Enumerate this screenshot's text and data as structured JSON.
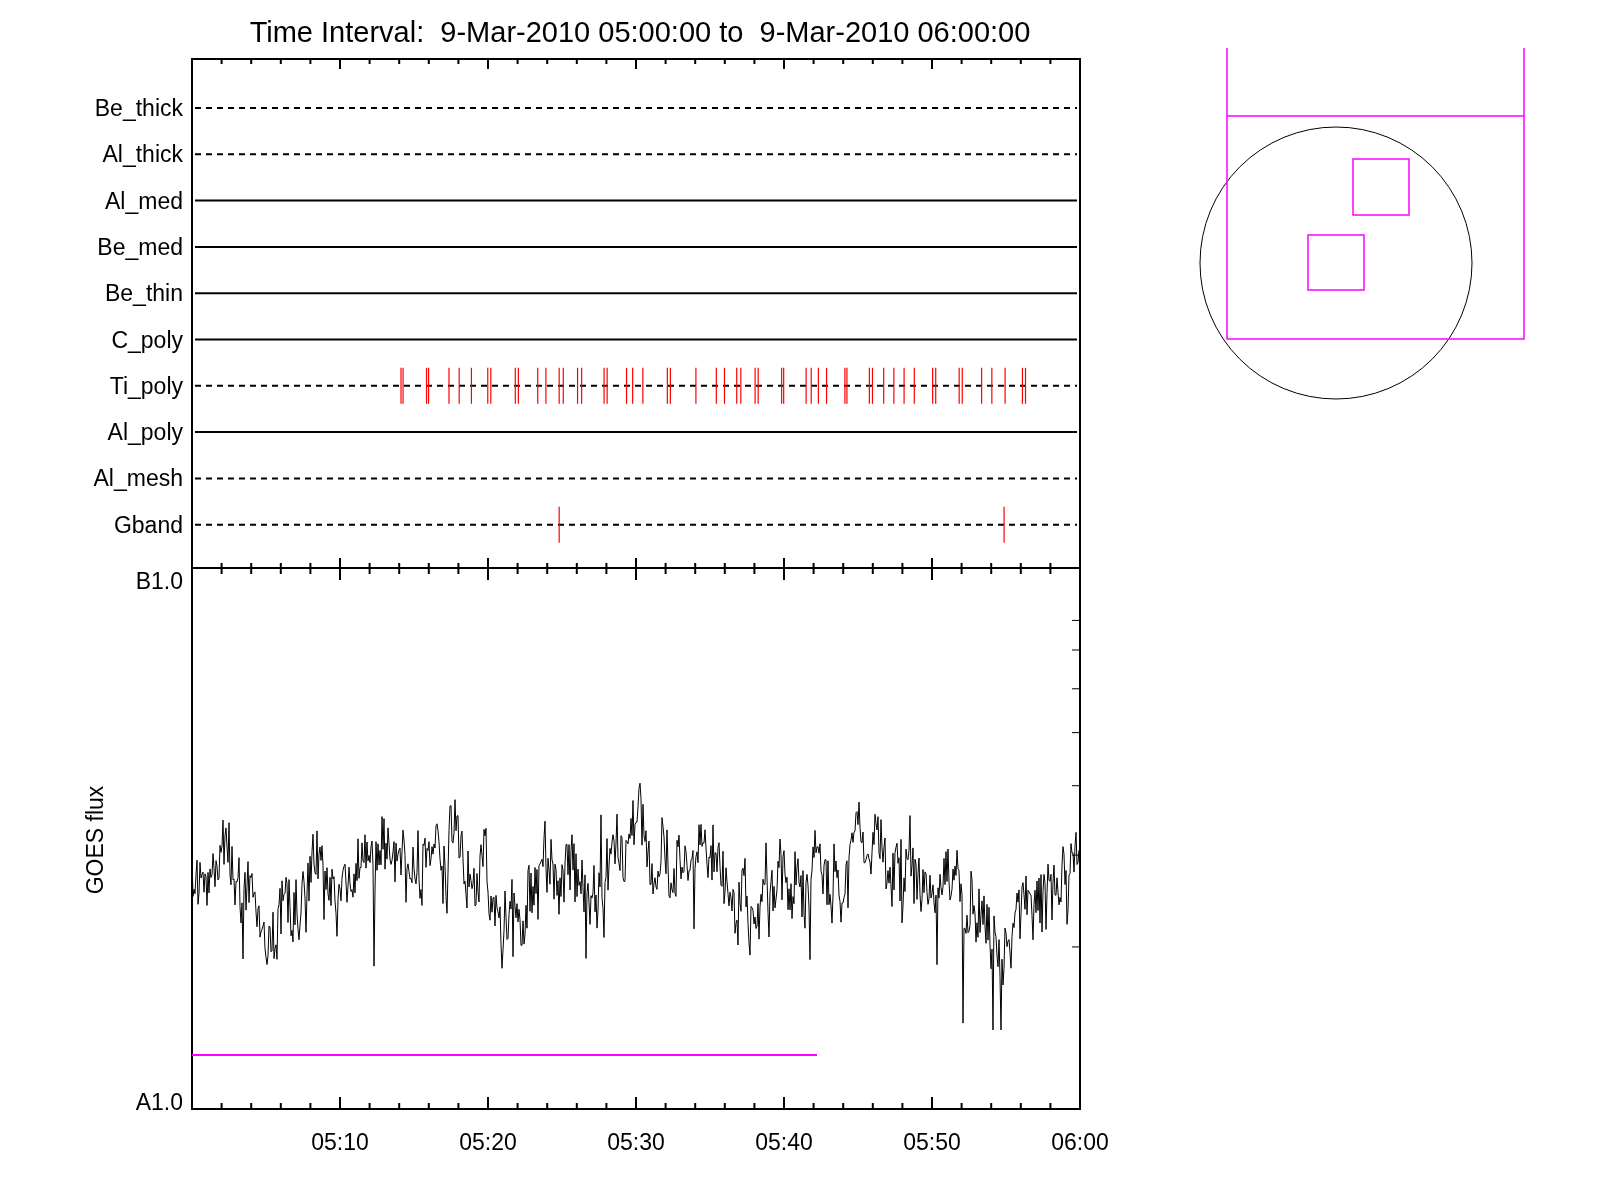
{
  "title": "Time Interval:  9-Mar-2010 05:00:00 to  9-Mar-2010 06:00:00",
  "channels": [
    {
      "name": "Be_thick",
      "kind": "dashed"
    },
    {
      "name": "Al_thick",
      "kind": "dashed"
    },
    {
      "name": "Al_med",
      "kind": "solid"
    },
    {
      "name": "Be_med",
      "kind": "solid"
    },
    {
      "name": "Be_thin",
      "kind": "solid"
    },
    {
      "name": "C_poly",
      "kind": "solid"
    },
    {
      "name": "Ti_poly",
      "kind": "dashed"
    },
    {
      "name": "Al_poly",
      "kind": "solid"
    },
    {
      "name": "Al_mesh",
      "kind": "dashed"
    },
    {
      "name": "Gband",
      "kind": "dashed"
    }
  ],
  "flux_panel": {
    "ylabel": "GOES flux",
    "y_top": "B1.0",
    "y_bottom": "A1.0"
  },
  "x_ticks": [
    "05:10",
    "05:20",
    "05:30",
    "05:40",
    "05:50",
    "06:00"
  ]
}
